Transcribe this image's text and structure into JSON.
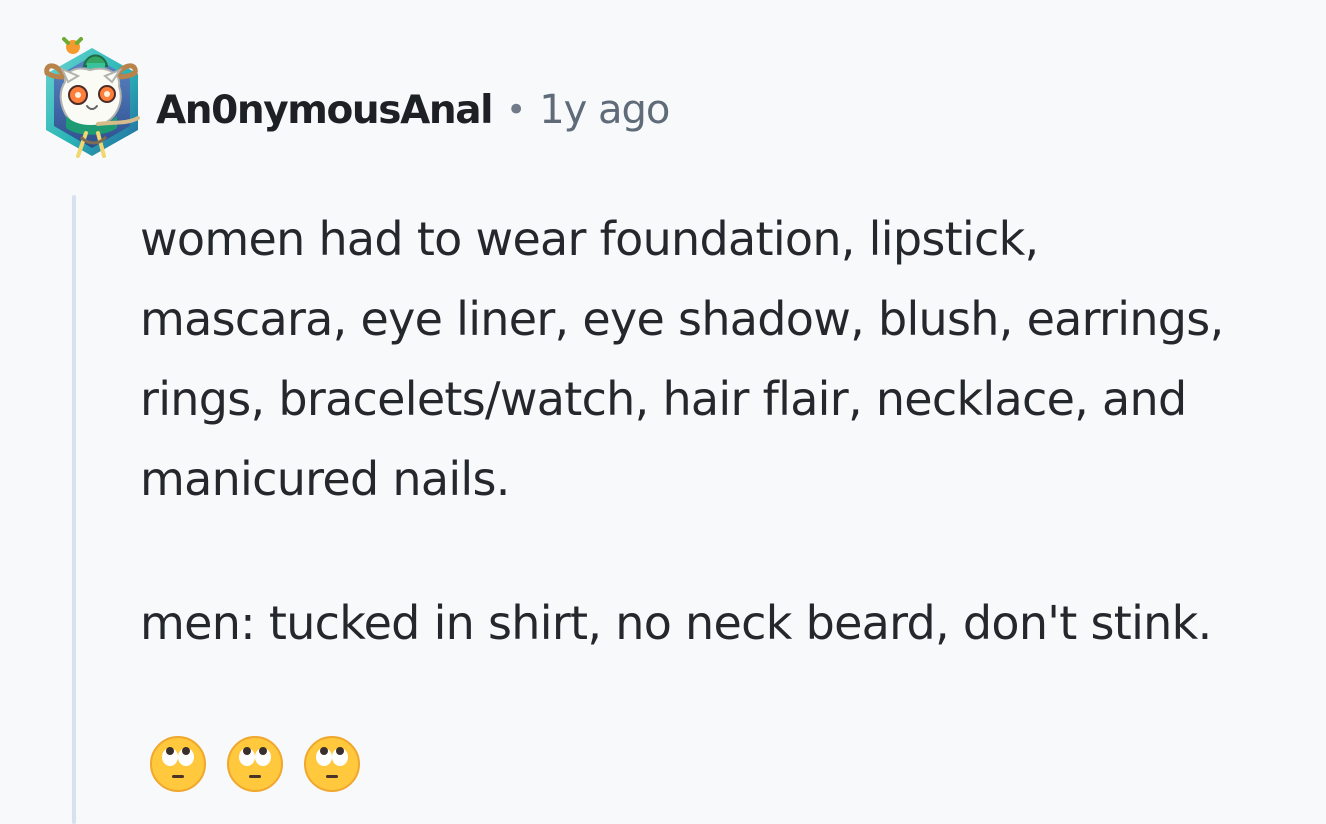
{
  "comment": {
    "author": "An0nymousAnal",
    "separator": "•",
    "time": "1y ago",
    "avatar_icon": "deer-cat-snoovatar-icon",
    "body": {
      "line_1": "women had to wear foundation, lipstick,",
      "line_2": "mascara, eye liner, eye shadow, blush, earrings,",
      "line_3": "rings, bracelets/watch, hair flair, necklace, and",
      "line_4": "manicured nails.",
      "paragraph_2": "men: tucked in shirt, no neck beard, don't stink."
    },
    "emojis": [
      {
        "icon": "face-with-rolling-eyes-icon"
      },
      {
        "icon": "face-with-rolling-eyes-icon"
      },
      {
        "icon": "face-with-rolling-eyes-icon"
      }
    ]
  },
  "colors": {
    "background": "#f8f9fb",
    "text": "#24282d",
    "muted": "#5f6b78",
    "thread_line": "#d7e1ef",
    "avatar_teal": "#28b7b0",
    "emoji_yellow": "#ffc83d"
  }
}
